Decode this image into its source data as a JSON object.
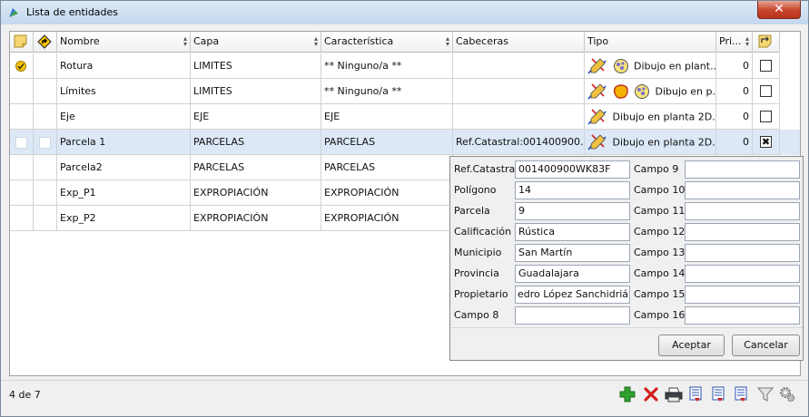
{
  "window": {
    "title": "Lista de entidades",
    "close_label": "✕"
  },
  "table": {
    "headers": {
      "nombre": "Nombre",
      "capa": "Capa",
      "caracteristica": "Característica",
      "cabeceras": "Cabeceras",
      "tipo": "Tipo",
      "prioridad": "Pri..."
    },
    "rows": [
      {
        "nombre": "Rotura",
        "capa": "LIMITES",
        "caracteristica": "** Ninguno/a **",
        "cabeceras": "",
        "tipo": "Dibujo en plant...",
        "prioridad": "0",
        "checked": false,
        "active": true
      },
      {
        "nombre": "Límites",
        "capa": "LIMITES",
        "caracteristica": "** Ninguno/a **",
        "cabeceras": "",
        "tipo": "Dibujo en p...",
        "prioridad": "0",
        "checked": false
      },
      {
        "nombre": "Eje",
        "capa": "EJE",
        "caracteristica": "EJE",
        "cabeceras": "",
        "tipo": "Dibujo en planta 2D...",
        "prioridad": "0",
        "checked": false
      },
      {
        "nombre": "Parcela 1",
        "capa": "PARCELAS",
        "caracteristica": "PARCELAS",
        "cabeceras": "Ref.Catastral:001400900...",
        "tipo": "Dibujo en planta 2D...",
        "prioridad": "0",
        "checked": true,
        "selected": true
      },
      {
        "nombre": "Parcela2",
        "capa": "PARCELAS",
        "caracteristica": "PARCELAS"
      },
      {
        "nombre": "Exp_P1",
        "capa": "EXPROPIACIÓN",
        "caracteristica": "EXPROPIACIÓN"
      },
      {
        "nombre": "Exp_P2",
        "capa": "EXPROPIACIÓN",
        "caracteristica": "EXPROPIACIÓN"
      }
    ]
  },
  "popup": {
    "left_fields": [
      {
        "label": "Ref.Catastral",
        "value": "001400900WK83F"
      },
      {
        "label": "Polígono",
        "value": "14"
      },
      {
        "label": "Parcela",
        "value": "9"
      },
      {
        "label": "Calificación",
        "value": "Rústica"
      },
      {
        "label": "Municipio",
        "value": "San Martín"
      },
      {
        "label": "Provincia",
        "value": "Guadalajara"
      },
      {
        "label": "Propietario",
        "value": "edro López Sanchidrián"
      },
      {
        "label": "Campo 8",
        "value": ""
      }
    ],
    "right_fields": [
      {
        "label": "Campo 9",
        "value": ""
      },
      {
        "label": "Campo 10",
        "value": ""
      },
      {
        "label": "Campo 11",
        "value": ""
      },
      {
        "label": "Campo 12",
        "value": ""
      },
      {
        "label": "Campo 13",
        "value": ""
      },
      {
        "label": "Campo 14",
        "value": ""
      },
      {
        "label": "Campo 15",
        "value": ""
      },
      {
        "label": "Campo 16",
        "value": ""
      }
    ],
    "accept_label": "Aceptar",
    "cancel_label": "Cancelar"
  },
  "status": {
    "count": "4 de 7"
  },
  "toolbar": {
    "icons": [
      "add-icon",
      "delete-icon",
      "print-icon",
      "export-list-icon",
      "export-list-2-icon",
      "export-list-3-icon",
      "filter-icon",
      "settings-icon"
    ]
  },
  "colors": {
    "selected_row": "#dce8f6",
    "add_green": "#2fa22f",
    "delete_red": "#d42020",
    "title_bar": "#c4d7ee"
  }
}
